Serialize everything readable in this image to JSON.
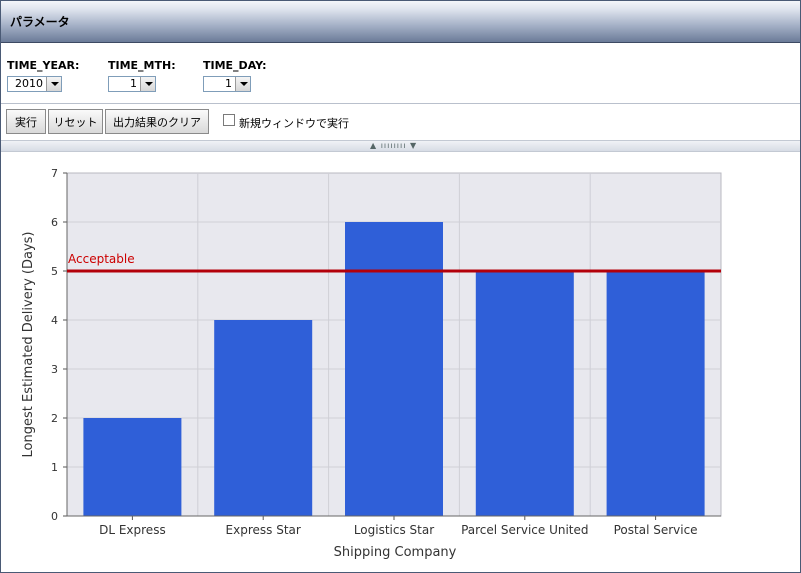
{
  "header": {
    "title": "パラメータ"
  },
  "params": [
    {
      "label": "TIME_YEAR:",
      "value": "2010"
    },
    {
      "label": "TIME_MTH:",
      "value": "1"
    },
    {
      "label": "TIME_DAY:",
      "value": "1"
    }
  ],
  "toolbar": {
    "run_label": "実行",
    "reset_label": "リセット",
    "clear_label": "出力結果のクリア",
    "new_window_label": "新規ウィンドウで実行",
    "new_window_checked": false
  },
  "splitter": {
    "grip_text": "▲ ıııııııı ▼"
  },
  "colors": {
    "bar": "#2f5fd8",
    "threshold": "#b3000a",
    "plot_bg": "#e8e8ee",
    "grid": "#cfcfd6"
  },
  "chart_data": {
    "type": "bar",
    "categories": [
      "DL Express",
      "Express Star",
      "Logistics Star",
      "Parcel Service United",
      "Postal Service"
    ],
    "values": [
      2,
      4,
      6,
      5,
      5
    ],
    "title": "",
    "xlabel": "Shipping Company",
    "ylabel": "Longest Estimated Delivery (Days)",
    "ylim": [
      0,
      7
    ],
    "yticks": [
      0,
      1,
      2,
      3,
      4,
      5,
      6,
      7
    ],
    "grid": true,
    "reference_line": {
      "value": 5,
      "label": "Acceptable"
    }
  }
}
